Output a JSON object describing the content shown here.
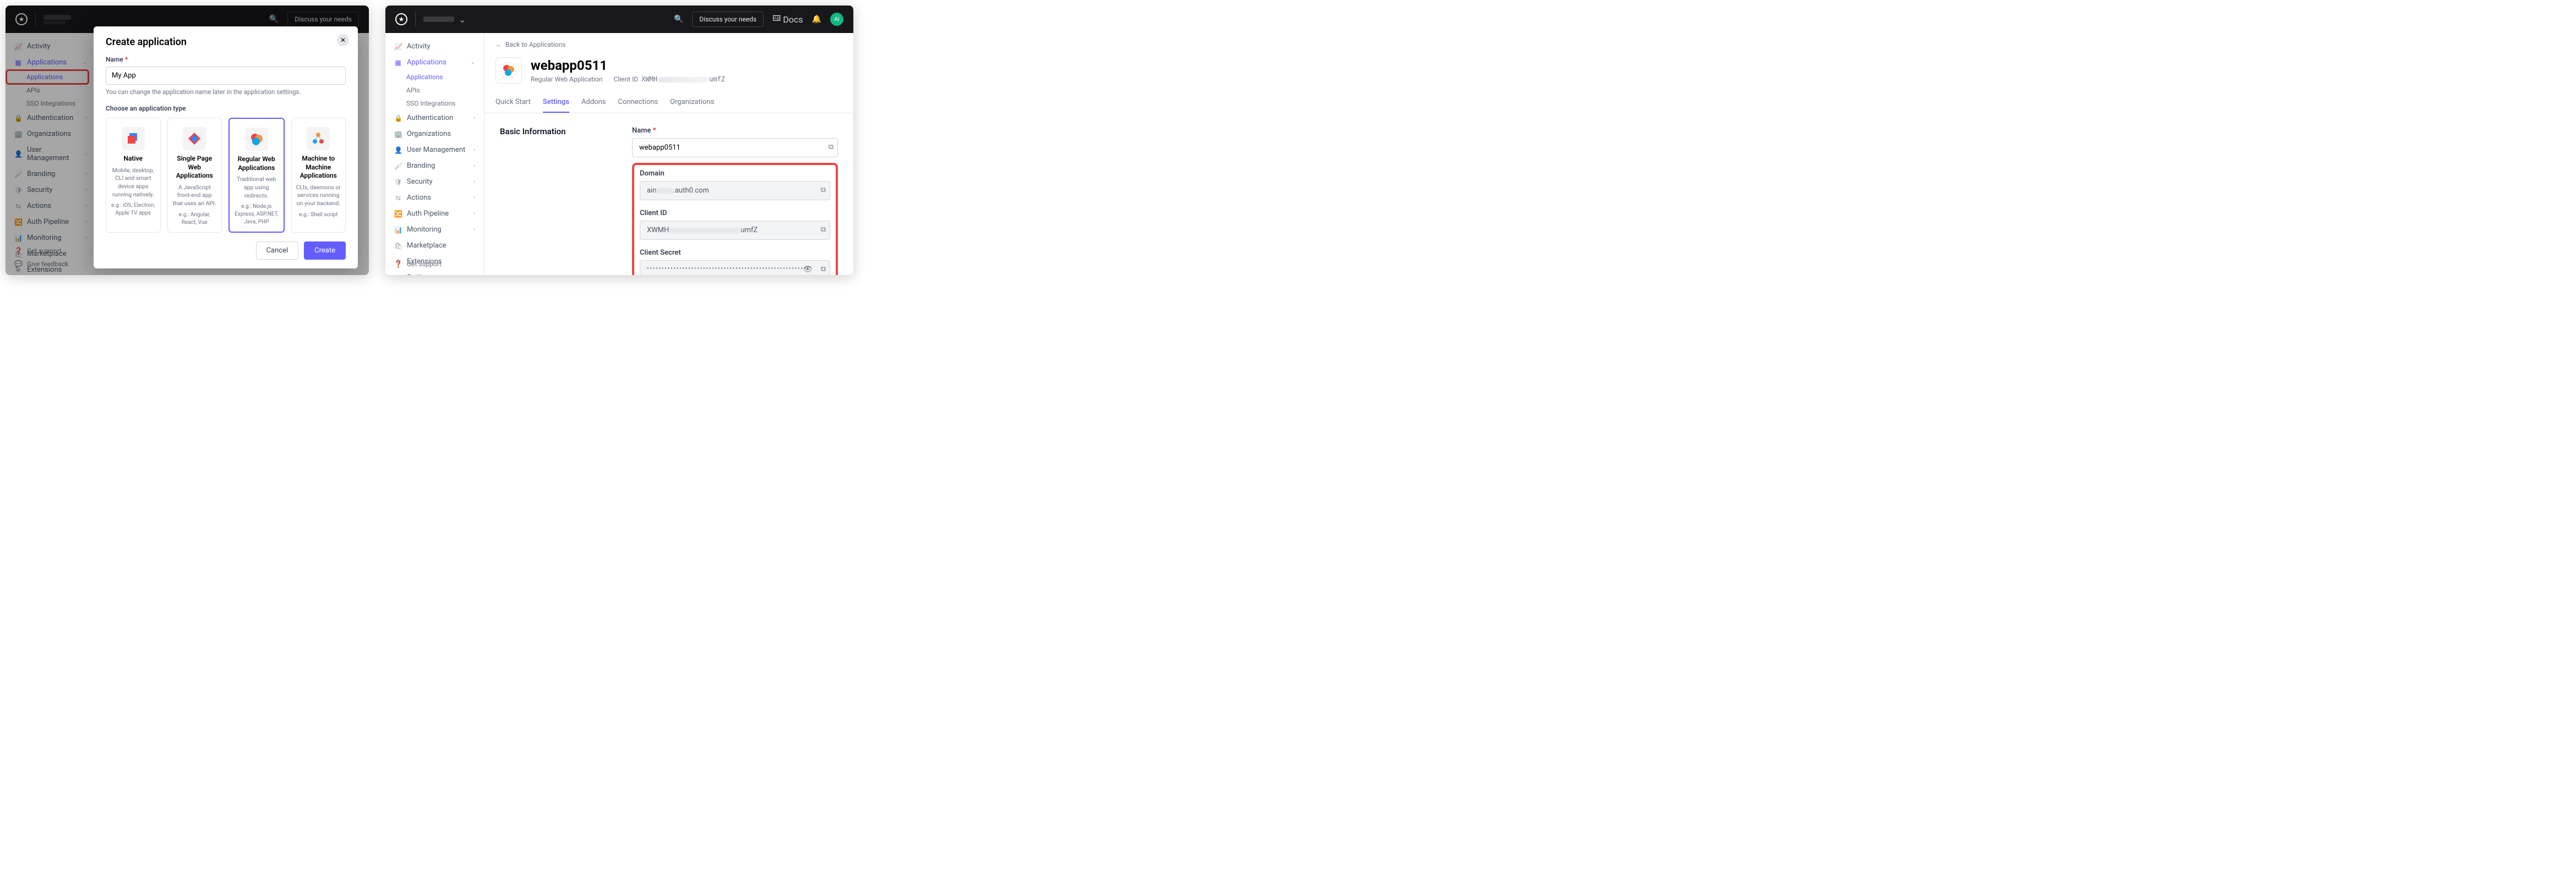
{
  "topbar": {
    "discuss_label": "Discuss your needs",
    "docs_label": "Docs",
    "avatar_initials": "AI"
  },
  "sidebar": {
    "activity": "Activity",
    "applications": "Applications",
    "applications_sub": "Applications",
    "apis": "APIs",
    "sso": "SSO Integrations",
    "authentication": "Authentication",
    "organizations": "Organizations",
    "user_management": "User Management",
    "branding": "Branding",
    "security": "Security",
    "actions": "Actions",
    "auth_pipeline": "Auth Pipeline",
    "monitoring": "Monitoring",
    "marketplace": "Marketplace",
    "extensions": "Extensions",
    "settings": "Settings",
    "get_support": "Get support",
    "give_feedback": "Give feedback"
  },
  "modal": {
    "title": "Create application",
    "name_label": "Name",
    "name_value": "My App",
    "name_help": "You can change the application name later in the application settings.",
    "choose_label": "Choose an application type",
    "cards": [
      {
        "title": "Native",
        "desc": "Mobile, desktop, CLI and smart device apps running natively.",
        "eg": "e.g.: iOS, Electron, Apple TV apps",
        "selected": false,
        "icon": "native"
      },
      {
        "title": "Single Page Web Applications",
        "desc": "A JavaScript front-end app that uses an API.",
        "eg": "e.g.: Angular, React, Vue",
        "selected": false,
        "icon": "spa"
      },
      {
        "title": "Regular Web Applications",
        "desc": "Traditional web app using redirects.",
        "eg": "e.g.: Node.js Express, ASP.NET, Java, PHP",
        "selected": true,
        "icon": "regular"
      },
      {
        "title": "Machine to Machine Applications",
        "desc": "CLIs, daemons or services running on your backend.",
        "eg": "e.g.: Shell script",
        "selected": false,
        "icon": "m2m"
      }
    ],
    "cancel_label": "Cancel",
    "create_label": "Create"
  },
  "app_page": {
    "breadcrumb": "Back to Applications",
    "title": "webapp0511",
    "type": "Regular Web Application",
    "client_id_label": "Client ID",
    "client_id_prefix": "XWMH",
    "client_id_suffix": "umfZ",
    "tabs": {
      "quick_start": "Quick Start",
      "settings": "Settings",
      "addons": "Addons",
      "connections": "Connections",
      "organizations": "Organizations"
    },
    "section_title": "Basic Information",
    "form": {
      "name_label": "Name",
      "name_value": "webapp0511",
      "domain_label": "Domain",
      "domain_prefix": "ain",
      "domain_suffix": ".auth0.com",
      "client_id_label": "Client ID",
      "client_id_value_prefix": "XWMH",
      "client_id_value_suffix": "umfZ",
      "client_secret_label": "Client Secret",
      "client_secret_value": "••••••••••••••••••••••••••••••••••••••••••••••••••••••••••••••••••••••••"
    }
  }
}
